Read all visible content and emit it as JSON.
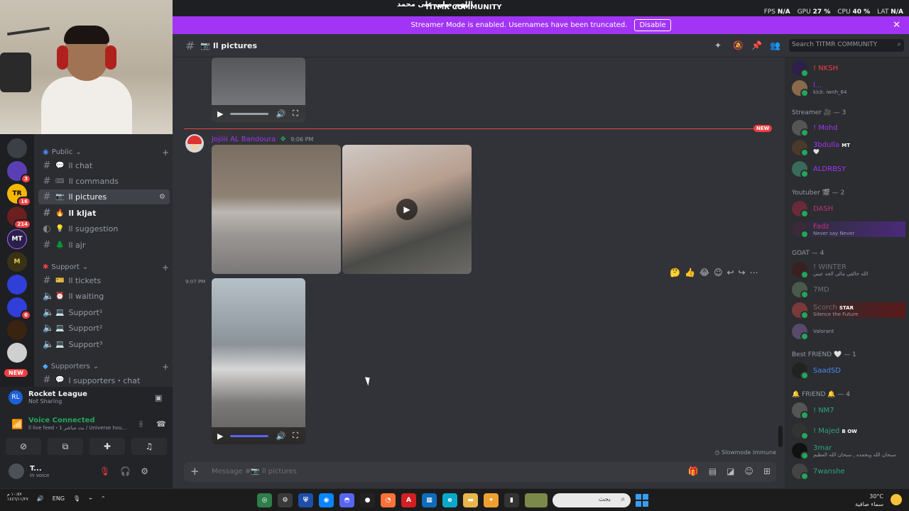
{
  "topbar": {
    "server_title": "TITMR COMMUNITY",
    "arabic_overlay": "اللهم صلي على محمد",
    "stats": [
      {
        "label": "FPS",
        "value": "N/A"
      },
      {
        "label": "GPU",
        "value": "27 %"
      },
      {
        "label": "CPU",
        "value": "40 %"
      },
      {
        "label": "LAT",
        "value": "N/A"
      }
    ]
  },
  "banner": {
    "text": "Streamer Mode is enabled. Usernames have been truncated.",
    "disable_label": "Disable"
  },
  "servers": [
    {
      "badge": ""
    },
    {
      "badge": "3"
    },
    {
      "label": "TR",
      "badge": "16",
      "color": "#f5b800"
    },
    {
      "badge": "214"
    },
    {
      "label": "MT",
      "badge": ""
    },
    {
      "label": "M",
      "badge": ""
    },
    {
      "badge": ""
    },
    {
      "badge": "6"
    },
    {
      "badge": ""
    },
    {
      "badge": ""
    }
  ],
  "servers_new_label": "NEW",
  "sidebar": {
    "categories": [
      {
        "name": "Public",
        "icon": "globe-icon"
      },
      {
        "name": "Support",
        "icon": "ribbon-icon"
      },
      {
        "name": "Supporters",
        "icon": "diamond-icon"
      }
    ],
    "channels": [
      {
        "name": "ll chat",
        "emoji": "💬"
      },
      {
        "name": "ll commands",
        "emoji": "🎟"
      },
      {
        "name": "ll pictures",
        "emoji": "📷"
      },
      {
        "name": "ll kljat",
        "emoji": "🔥"
      },
      {
        "name": "ll suggestion",
        "emoji": "💡"
      },
      {
        "name": "ll ajr",
        "emoji": "🌲"
      },
      {
        "name": "ll tickets",
        "emoji": "🎫"
      },
      {
        "name": "ll waiting",
        "emoji": "⏰"
      },
      {
        "name": "Support¹",
        "emoji": "💻"
      },
      {
        "name": "Support²",
        "emoji": "💻"
      },
      {
        "name": "Support³",
        "emoji": "💻"
      },
      {
        "name": "l supporters・chat",
        "emoji": "💬"
      }
    ]
  },
  "activity": {
    "game_name": "Rocket League",
    "game_status": "Not Sharing"
  },
  "voice": {
    "status": "Voice Connected",
    "channel": "ll live feed・بث مباشر 1 / Universe hou..."
  },
  "user": {
    "name": "T...",
    "status": "In voice"
  },
  "channel_header": {
    "name": "ll pictures"
  },
  "search": {
    "placeholder": "Search TITMR COMMUNITY"
  },
  "messages": {
    "new_label": "NEW",
    "author": "Jojiiii AL Bandoura",
    "time1": "9:06 PM",
    "time2": "9:07 PM",
    "slowmode": "Slowmode Immune"
  },
  "composer": {
    "placeholder": "Message #📷 ll pictures"
  },
  "members": {
    "groups": [
      {
        "title": "Streamer 🎥 — 3"
      },
      {
        "title": "Youtuber 🎬 — 2"
      },
      {
        "title": "GOAT — 4"
      },
      {
        "title": "Best FRIEND 🤍 — 1"
      },
      {
        "title": "🔔 FRIEND 🔔 — 4"
      }
    ],
    "people": [
      {
        "name": "! NKSH",
        "sub": "",
        "color": "#f23f43"
      },
      {
        "name": "l...",
        "sub": "kick: iwnh_64",
        "color": "#a235f5"
      },
      {
        "name": "! Mohd",
        "sub": "",
        "color": "#a235f5"
      },
      {
        "name": "3bdulla",
        "sub": "🤍",
        "tag": "MT",
        "color": "#a235f5"
      },
      {
        "name": "ALDRBSY",
        "sub": "",
        "color": "#a235f5"
      },
      {
        "name": "DASH",
        "sub": "",
        "color": "#c4327a"
      },
      {
        "name": "Fadz",
        "sub": "Never say Never",
        "color": "#c4327a"
      },
      {
        "name": "! WINTER",
        "sub": "الله خالقي مالي الحد عيني",
        "color": "#6d6f78"
      },
      {
        "name": "7MD",
        "sub": "",
        "color": "#6d6f78"
      },
      {
        "name": "Scorch",
        "sub": "Silence the Future",
        "tag": "STAR",
        "color": "#6d6f78"
      },
      {
        "name": "",
        "sub": "Valorant",
        "color": "#6d6f78"
      },
      {
        "name": "SaadSD",
        "sub": "",
        "color": "#4e86f5"
      },
      {
        "name": "! NM7",
        "sub": "",
        "color": "#2fa47a"
      },
      {
        "name": "! Majed",
        "sub": "",
        "tag": "B OW",
        "color": "#2fa47a"
      },
      {
        "name": "3mar",
        "sub": "سبحان الله وبحمده , سبحان الله العظيم",
        "color": "#2fa47a"
      },
      {
        "name": "7wanshe",
        "sub": "",
        "color": "#2fa47a"
      }
    ]
  },
  "taskbar": {
    "clock_time": "١٠:٥٧ م",
    "clock_date": "١٤٤٦/١١/٢٧",
    "lang": "ENG",
    "search_text": "بحث",
    "temp": "30°C",
    "weather_text": "سماء صافية"
  }
}
